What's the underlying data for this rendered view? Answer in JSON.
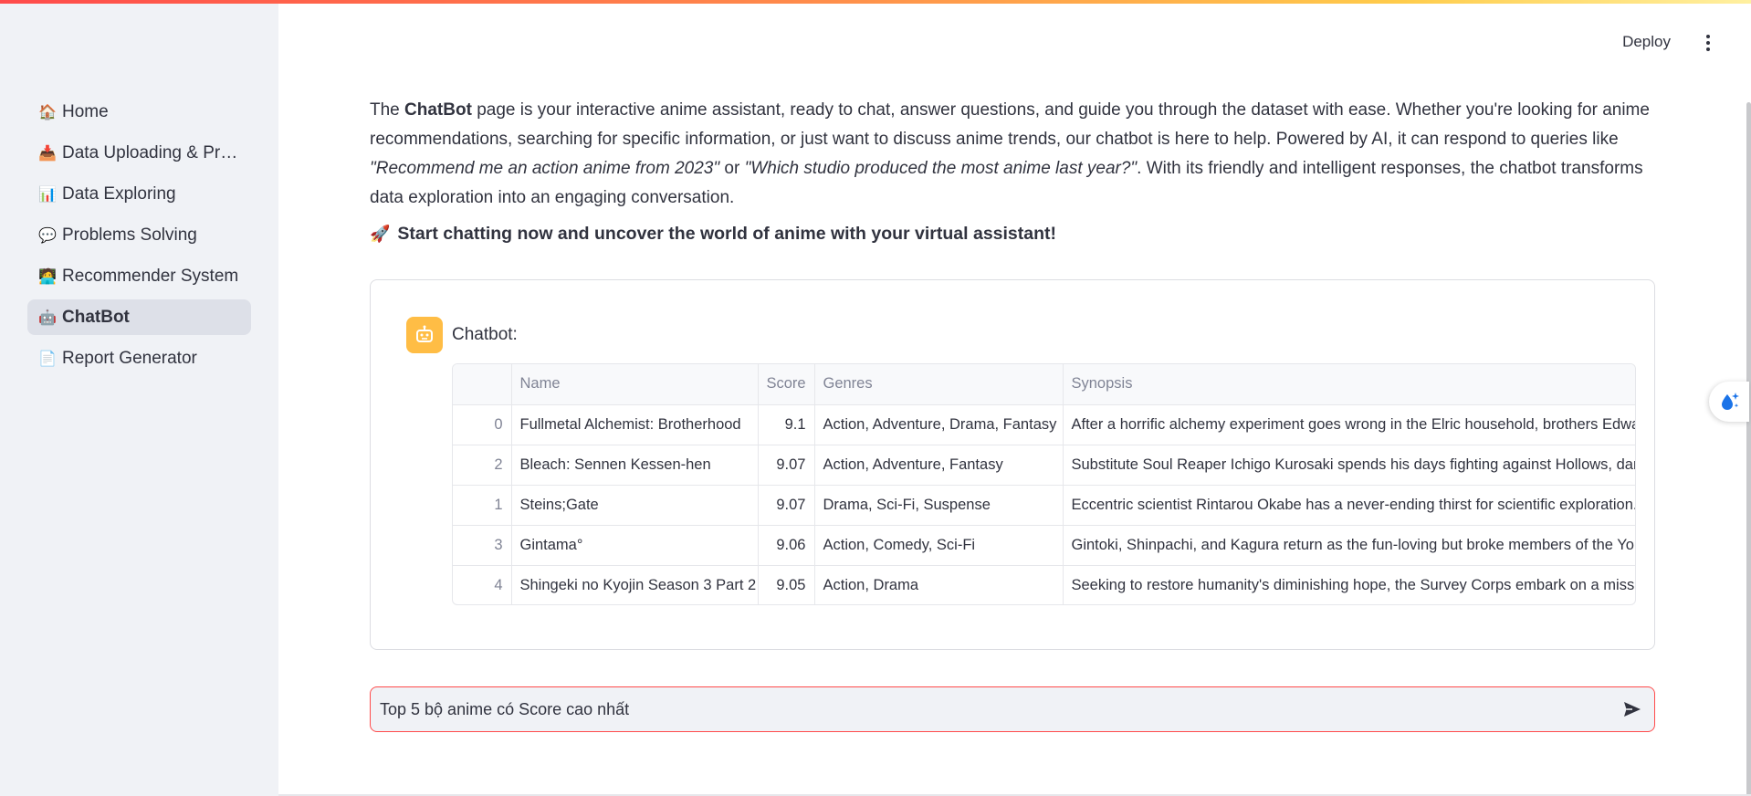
{
  "sidebar": {
    "items": [
      {
        "icon": "house-icon",
        "glyph": "🏠",
        "label": "Home",
        "active": false
      },
      {
        "icon": "inbox-tray-icon",
        "glyph": "📥",
        "label": "Data Uploading & Pre…",
        "active": false
      },
      {
        "icon": "bar-chart-icon",
        "glyph": "📊",
        "label": "Data Exploring",
        "active": false
      },
      {
        "icon": "speech-balloon-icon",
        "glyph": "💬",
        "label": "Problems Solving",
        "active": false
      },
      {
        "icon": "user-desk-icon",
        "glyph": "🧑‍💻",
        "label": "Recommender System",
        "active": false
      },
      {
        "icon": "robot-icon",
        "glyph": "🤖",
        "label": "ChatBot",
        "active": true
      },
      {
        "icon": "page-icon",
        "glyph": "📄",
        "label": "Report Generator",
        "active": false
      }
    ]
  },
  "header": {
    "deploy_label": "Deploy",
    "menu_icon": "vertical-dots-icon"
  },
  "intro": {
    "p1": "The ",
    "bold": "ChatBot",
    "p2": " page is your interactive anime assistant, ready to chat, answer questions, and guide you through the dataset with ease. Whether you're looking for anime recommendations, searching for specific information, or just want to discuss anime trends, our chatbot is here to help. Powered by AI, it can respond to queries like ",
    "q1": "\"Recommend me an action anime from 2023\"",
    "p3": " or ",
    "q2": "\"Which studio produced the most anime last year?\"",
    "p4": ". With its friendly and intelligent responses, the chatbot transforms data exploration into an engaging conversation."
  },
  "cta": {
    "icon": "rocket-icon",
    "text": "Start chatting now and uncover the world of anime with your virtual assistant!"
  },
  "chat": {
    "bot_label": "Chatbot:",
    "avatar_icon": "robot-icon",
    "avatar_color": "#ffbd45",
    "table": {
      "columns": [
        "",
        "Name",
        "Score",
        "Genres",
        "Synopsis"
      ],
      "rows": [
        {
          "index": "0",
          "name": "Fullmetal Alchemist: Brotherhood",
          "score": "9.1",
          "genres": "Action, Adventure, Drama, Fantasy",
          "synopsis": "After a horrific alchemy experiment goes wrong in the Elric household, brothers Edwa"
        },
        {
          "index": "2",
          "name": "Bleach: Sennen Kessen-hen",
          "score": "9.07",
          "genres": "Action, Adventure, Fantasy",
          "synopsis": "Substitute Soul Reaper Ichigo Kurosaki spends his days fighting against Hollows, dan"
        },
        {
          "index": "1",
          "name": "Steins;Gate",
          "score": "9.07",
          "genres": "Drama, Sci-Fi, Suspense",
          "synopsis": "Eccentric scientist Rintarou Okabe has a never-ending thirst for scientific exploration."
        },
        {
          "index": "3",
          "name": "Gintama°",
          "score": "9.06",
          "genres": "Action, Comedy, Sci-Fi",
          "synopsis": "Gintoki, Shinpachi, and Kagura return as the fun-loving but broke members of the Yor"
        },
        {
          "index": "4",
          "name": "Shingeki no Kyojin Season 3 Part 2",
          "score": "9.05",
          "genres": "Action, Drama",
          "synopsis": "Seeking to restore humanity's diminishing hope, the Survey Corps embark on a missi"
        }
      ]
    }
  },
  "input": {
    "value": "Top 5 bộ anime có Score cao nhất",
    "send_icon": "send-arrow-icon",
    "accent": "#ff4b4b"
  },
  "floating_button": {
    "icon": "sparkle-drop-icon"
  }
}
